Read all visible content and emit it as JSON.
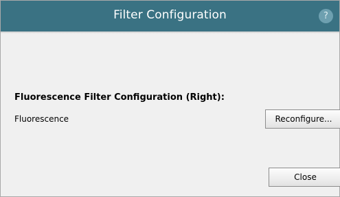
{
  "dialog": {
    "title": "Filter Configuration",
    "help_label": "?"
  },
  "filter_section": {
    "heading": "Fluorescence Filter Configuration (Right):",
    "row_label": "Fluorescence",
    "reconfigure_label": "Reconfigure..."
  },
  "footer": {
    "close_label": "Close"
  },
  "colors": {
    "titlebar": "#3a7283",
    "help_button": "#6ea0b0",
    "background": "#f0f0f0"
  }
}
